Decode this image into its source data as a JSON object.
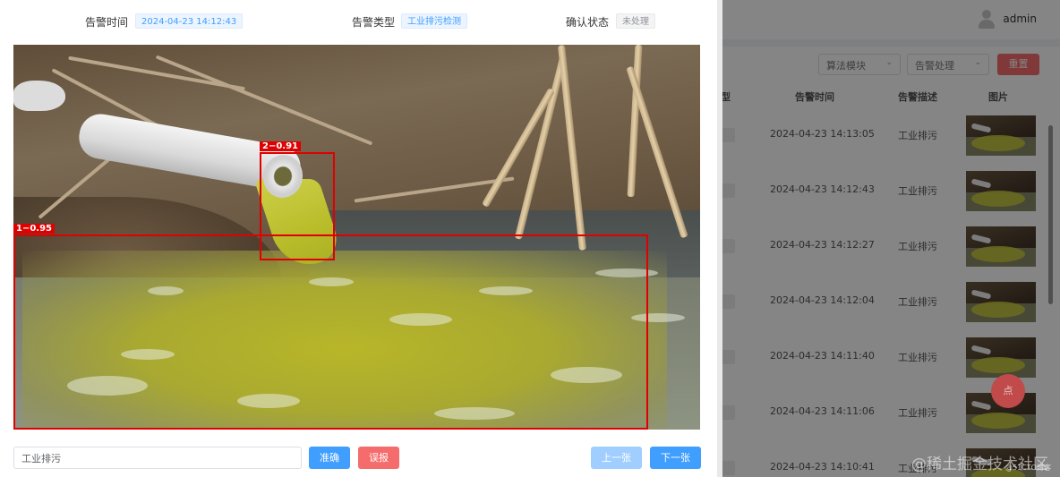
{
  "alert_info": {
    "time_label": "告警时间",
    "time_value": "2024-04-23 14:12:43",
    "type_label": "告警类型",
    "type_value": "工业排污检测",
    "status_label": "确认状态",
    "status_value": "未处理"
  },
  "detections": [
    {
      "label": "2−0.91"
    },
    {
      "label": "1−0.95"
    }
  ],
  "actions": {
    "description_value": "工业排污",
    "confirm_label": "准确",
    "false_alarm_label": "误报",
    "prev_label": "上一张",
    "next_label": "下一张"
  },
  "background": {
    "username": "admin",
    "filter_algorithm": "算法模块",
    "filter_handling": "告警处理",
    "reset_label": "重置",
    "columns": [
      "型",
      "告警时间",
      "告警描述",
      "图片"
    ],
    "rows": [
      {
        "time": "2024-04-23 14:13:05",
        "desc": "工业排污"
      },
      {
        "time": "2024-04-23 14:12:43",
        "desc": "工业排污"
      },
      {
        "time": "2024-04-23 14:12:27",
        "desc": "工业排污"
      },
      {
        "time": "2024-04-23 14:12:04",
        "desc": "工业排污"
      },
      {
        "time": "2024-04-23 14:11:40",
        "desc": "工业排污"
      },
      {
        "time": "2024-04-23 14:11:06",
        "desc": "工业排污"
      },
      {
        "time": "2024-04-23 14:10:41",
        "desc": "工业排污"
      }
    ],
    "float_badge": "点",
    "watermark": "@稀土掘金技术社区",
    "watermark_small": "@51CTO博客"
  },
  "colors": {
    "primary": "#409eff",
    "danger": "#f56c6c",
    "box": "#e00000"
  }
}
